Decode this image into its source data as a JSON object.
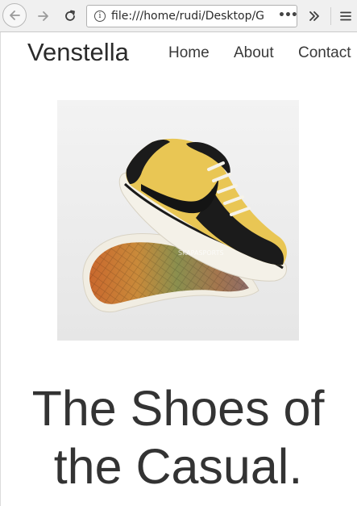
{
  "browser": {
    "url": "file:///home/rudi/Desktop/G",
    "url_more": "•••"
  },
  "site": {
    "brand": "Venstella",
    "nav": [
      {
        "label": "Home"
      },
      {
        "label": "About"
      },
      {
        "label": "Contact"
      }
    ]
  },
  "hero": {
    "title_line1": "The Shoes of",
    "title_line2": "the Casual."
  },
  "product_image": {
    "watermark": "SKAPASPORTS",
    "colors": {
      "upper": "#e8c652",
      "suede": "#1c1c1c",
      "sole": "#f2efe6"
    }
  }
}
